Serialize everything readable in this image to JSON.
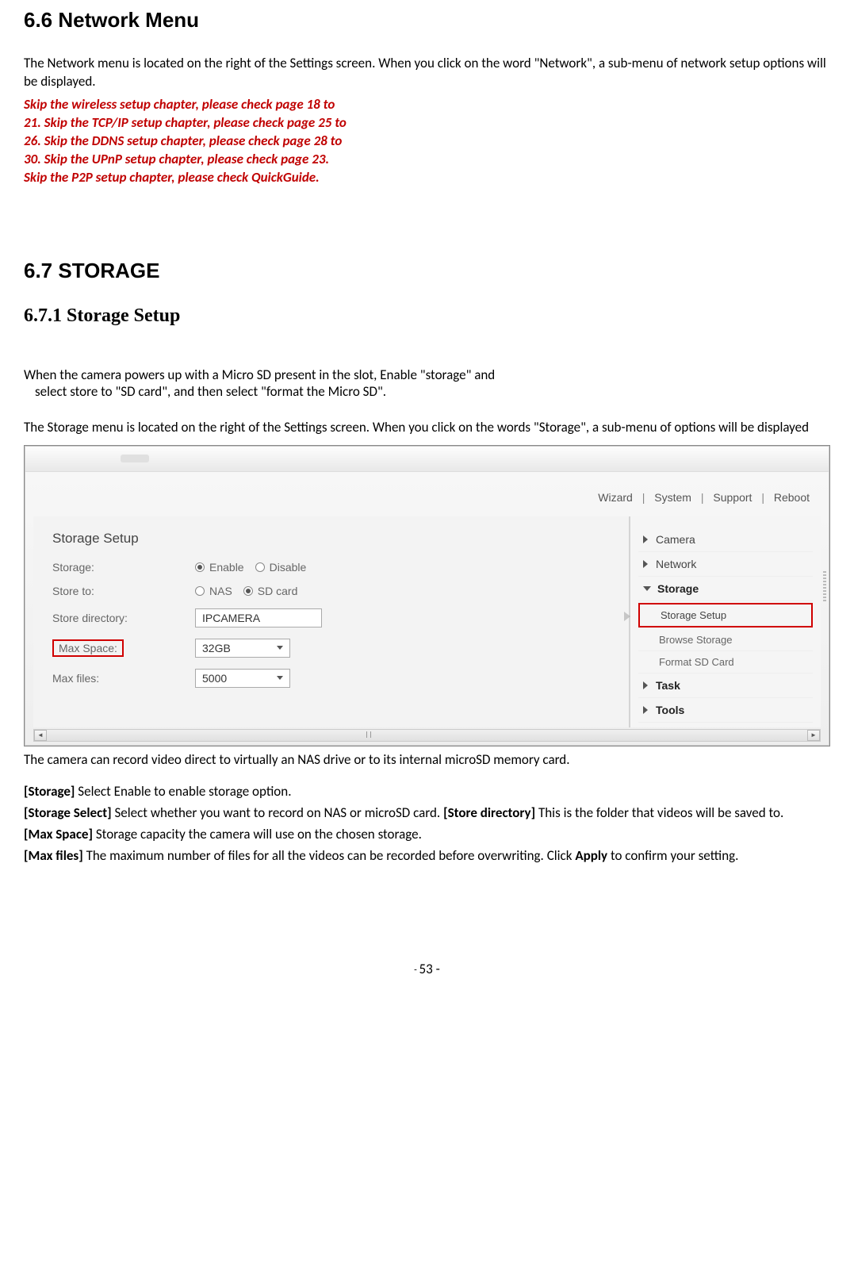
{
  "section66": {
    "title": "6.6 Network Menu",
    "intro": "The Network menu is located on the right of the Settings screen. When you click on the word \"Network\", a sub-menu of network setup options will be displayed.",
    "notes": [
      "Skip the wireless setup chapter, please check page 18 to",
      "21. Skip the TCP/IP setup chapter, please check page 25 to",
      "26. Skip the DDNS setup chapter, please check page 28 to",
      "30. Skip the UPnP setup chapter, please check page 23.",
      "Skip the P2P setup chapter, please check QuickGuide."
    ]
  },
  "section67": {
    "title": "6.7 STORAGE",
    "sub_title": "6.7.1 Storage Setup",
    "p1a": "When the camera powers up with a Micro SD present in the slot, Enable \"storage\" and",
    "p1b": "select store to \"SD card\", and then select \"format the Micro SD\".",
    "p2": "The Storage menu is located on the right of the Settings screen. When you click on the words \"Storage\", a sub-menu of options will be displayed",
    "after_img": "The camera can record video direct to virtually an NAS drive or to its internal microSD memory card.",
    "bullets": {
      "storage_label": "[Storage]",
      "storage_text": " Select Enable to enable storage option.",
      "select_label": "[Storage Select]",
      "select_text": " Select whether you want to record on NAS or microSD card. ",
      "dir_label": "[Store directory]",
      "dir_text": " This is the folder that videos will be saved to.",
      "max_space_label": "[Max Space]",
      "max_space_text": " Storage capacity the camera will use on the chosen storage.",
      "max_files_label": "[Max files]",
      "max_files_text": " The maximum number of files for all the videos can be recorded before overwriting. Click ",
      "apply_label": "Apply",
      "apply_tail": " to confirm your setting."
    }
  },
  "ui": {
    "topnav": {
      "wizard": "Wizard",
      "system": "System",
      "support": "Support",
      "reboot": "Reboot",
      "sep": "|"
    },
    "panel_title": "Storage Setup",
    "rows": {
      "storage": {
        "label": "Storage:",
        "enable": "Enable",
        "disable": "Disable"
      },
      "store_to": {
        "label": "Store to:",
        "nas": "NAS",
        "sd": "SD card"
      },
      "dir": {
        "label": "Store directory:",
        "value": "IPCAMERA"
      },
      "max_space": {
        "label": "Max Space:",
        "value": "32GB"
      },
      "max_files": {
        "label": "Max files:",
        "value": "5000"
      }
    },
    "side": {
      "camera": "Camera",
      "network": "Network",
      "storage": "Storage",
      "storage_setup": "Storage Setup",
      "browse": "Browse Storage",
      "format": "Format SD Card",
      "task": "Task",
      "tools": "Tools"
    }
  },
  "page_num": "53"
}
